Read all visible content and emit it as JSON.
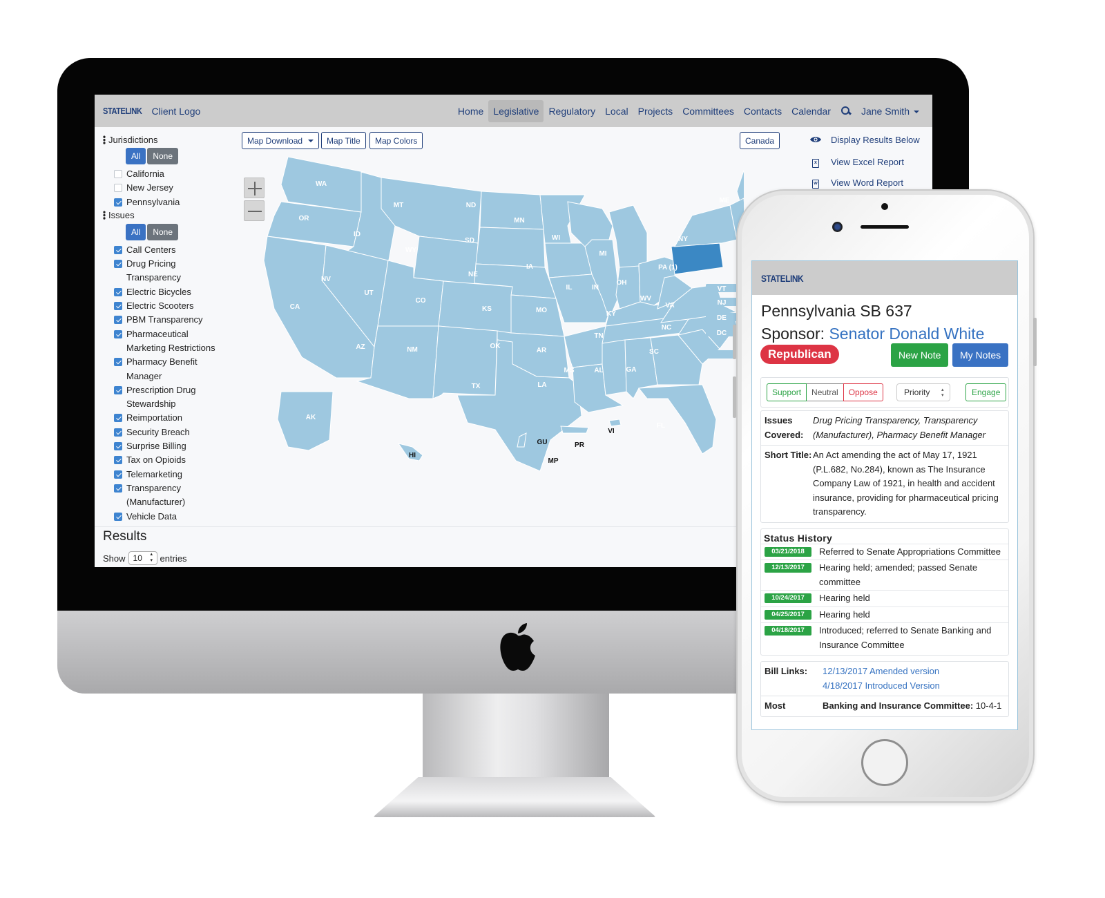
{
  "desktop": {
    "navbar": {
      "brand": "STATELINK",
      "client_logo": "Client Logo",
      "items": [
        {
          "label": "Home",
          "active": false
        },
        {
          "label": "Legislative",
          "active": true
        },
        {
          "label": "Regulatory",
          "active": false
        },
        {
          "label": "Local",
          "active": false
        },
        {
          "label": "Projects",
          "active": false
        },
        {
          "label": "Committees",
          "active": false
        },
        {
          "label": "Contacts",
          "active": false
        },
        {
          "label": "Calendar",
          "active": false
        }
      ],
      "search_icon": "search-icon",
      "user": "Jane Smith"
    },
    "sidebar": {
      "jurisdictions": {
        "title": "Jurisdictions",
        "all_label": "All",
        "none_label": "None",
        "items": [
          {
            "label": "California",
            "checked": false
          },
          {
            "label": "New Jersey",
            "checked": false
          },
          {
            "label": "Pennsylvania",
            "checked": true
          }
        ]
      },
      "issues": {
        "title": "Issues",
        "all_label": "All",
        "none_label": "None",
        "items": [
          {
            "label": "Call Centers",
            "checked": true
          },
          {
            "label": "Drug Pricing Transparency",
            "checked": true
          },
          {
            "label": "Electric Bicycles",
            "checked": true
          },
          {
            "label": "Electric Scooters",
            "checked": true
          },
          {
            "label": "PBM Transparency",
            "checked": true
          },
          {
            "label": "Pharmaceutical Marketing Restrictions",
            "checked": true
          },
          {
            "label": "Pharmacy Benefit Manager",
            "checked": true
          },
          {
            "label": "Prescription Drug Stewardship",
            "checked": true
          },
          {
            "label": "Reimportation",
            "checked": true
          },
          {
            "label": "Security Breach",
            "checked": true
          },
          {
            "label": "Surprise Billing",
            "checked": true
          },
          {
            "label": "Tax on Opioids",
            "checked": true
          },
          {
            "label": "Telemarketing",
            "checked": true
          },
          {
            "label": "Transparency (Manufacturer)",
            "checked": true
          },
          {
            "label": "Vehicle Data",
            "checked": true
          }
        ]
      }
    },
    "map_toolbar": {
      "download_label": "Map Download",
      "title_label": "Map Title",
      "colors_label": "Map Colors",
      "canada_label": "Canada"
    },
    "map": {
      "base_color": "#9ec8e0",
      "highlight_color": "#3b88c4",
      "highlighted_state": "PA (1)",
      "state_labels": [
        "WA",
        "OR",
        "CA",
        "ID",
        "NV",
        "MT",
        "WY",
        "UT",
        "AZ",
        "CO",
        "NM",
        "ND",
        "SD",
        "NE",
        "KS",
        "OK",
        "TX",
        "MN",
        "IA",
        "MO",
        "AR",
        "LA",
        "WI",
        "IL",
        "MI",
        "IN",
        "OH",
        "KY",
        "TN",
        "MS",
        "AL",
        "GA",
        "FL",
        "SC",
        "NC",
        "VA",
        "WV",
        "PA (1)",
        "NY",
        "ME",
        "AK",
        "HI",
        "GU",
        "MP",
        "PR",
        "VI"
      ],
      "small_state_boxes": [
        "VT",
        "NJ",
        "DE",
        "DC",
        ""
      ]
    },
    "actions": [
      {
        "icon": "eye-icon",
        "label": "Display Results Below"
      },
      {
        "icon": "excel-file-icon",
        "label": "View Excel Report"
      },
      {
        "icon": "word-file-icon",
        "label": "View Word Report"
      }
    ],
    "results": {
      "title": "Results",
      "show_label": "Show",
      "entries_value": "10",
      "entries_label": "entries"
    }
  },
  "phone": {
    "brand": "STATELINK",
    "bill_title": "Pennsylvania SB 637",
    "sponsor_label": "Sponsor:",
    "sponsor_name": "Senator Donald White",
    "party": "Republican",
    "new_note_label": "New Note",
    "my_notes_label": "My Notes",
    "stance": {
      "support": "Support",
      "neutral": "Neutral",
      "oppose": "Oppose"
    },
    "priority_label": "Priority",
    "engage_label": "Engage",
    "issues_key": "Issues Covered:",
    "issues_value": "Drug Pricing Transparency, Transparency (Manufacturer), Pharmacy Benefit Manager",
    "short_title_key": "Short Title:",
    "short_title_value": "An Act amending the act of May 17, 1921 (P.L.682, No.284), known as The Insurance Company Law of 1921, in health and accident insurance, providing for pharmaceutical pricing transparency.",
    "status_history_title": "Status History",
    "status_history": [
      {
        "date": "03/21/2018",
        "text": "Referred to Senate Appropriations Committee"
      },
      {
        "date": "12/13/2017",
        "text": "Hearing held; amended; passed Senate committee"
      },
      {
        "date": "10/24/2017",
        "text": "Hearing held"
      },
      {
        "date": "04/25/2017",
        "text": "Hearing held"
      },
      {
        "date": "04/18/2017",
        "text": "Introduced; referred to Senate Banking and Insurance Committee"
      }
    ],
    "bill_links_key": "Bill Links:",
    "bill_links": [
      "12/13/2017 Amended version",
      "4/18/2017 Introduced Version"
    ],
    "most_key": "Most",
    "most_value_bold": "Banking and Insurance Committee:",
    "most_value": "10-4-1"
  }
}
